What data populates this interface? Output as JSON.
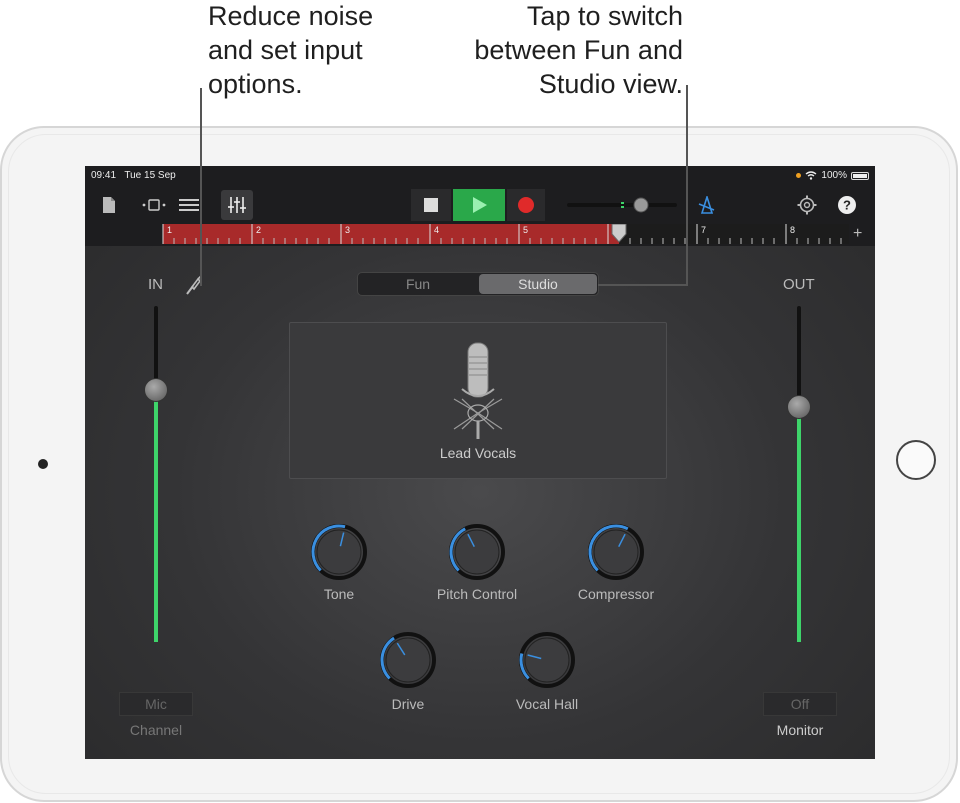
{
  "callouts": {
    "left": [
      "Reduce noise",
      "and set input",
      "options."
    ],
    "right": [
      "Tap to switch",
      "between Fun and",
      "Studio view."
    ]
  },
  "status": {
    "time": "09:41",
    "date": "Tue 15 Sep",
    "battery": "100%"
  },
  "ruler": {
    "numbers": [
      "1",
      "2",
      "3",
      "4",
      "5",
      "6",
      "7",
      "8"
    ],
    "add_label": "+"
  },
  "view_toggle": {
    "fun": "Fun",
    "studio": "Studio",
    "selected": "Studio"
  },
  "input": {
    "label": "IN",
    "level": 0.75,
    "channel_value": "Mic",
    "channel_label": "Channel"
  },
  "output": {
    "label": "OUT",
    "level": 0.7,
    "monitor_value": "Off",
    "monitor_label": "Monitor"
  },
  "patch": {
    "name": "Lead Vocals"
  },
  "knobs": [
    {
      "label": "Tone",
      "value": 0.55
    },
    {
      "label": "Pitch Control",
      "value": 0.4
    },
    {
      "label": "Compressor",
      "value": 0.6
    },
    {
      "label": "Drive",
      "value": 0.38
    },
    {
      "label": "Vocal Hall",
      "value": 0.22
    }
  ],
  "colors": {
    "accent_blue": "#3a8fe0",
    "level_green": "#3ed46a",
    "record_red": "#e02a2a",
    "play_green": "#2aa84a",
    "region_red": "#a82a2a"
  }
}
